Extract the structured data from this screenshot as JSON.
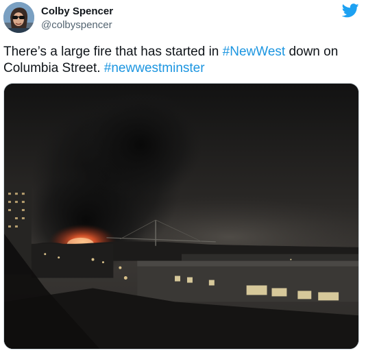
{
  "author": {
    "name": "Colby Spencer",
    "handle": "@colbyspencer",
    "avatar_icon": "profile-avatar"
  },
  "platform_icon": "twitter-bird-icon",
  "tweet": {
    "text_part1": "There’s a large fire that has started in ",
    "hashtag1": "#NewWest",
    "text_part2": " down on Columbia Street. ",
    "hashtag2": "#newwestminster"
  },
  "media": {
    "description_icon": "night-fire-photo"
  },
  "colors": {
    "hashtag": "#1b95e0",
    "twitter_blue": "#1da1f2",
    "handle_gray": "#536471",
    "text": "#0f1419"
  }
}
